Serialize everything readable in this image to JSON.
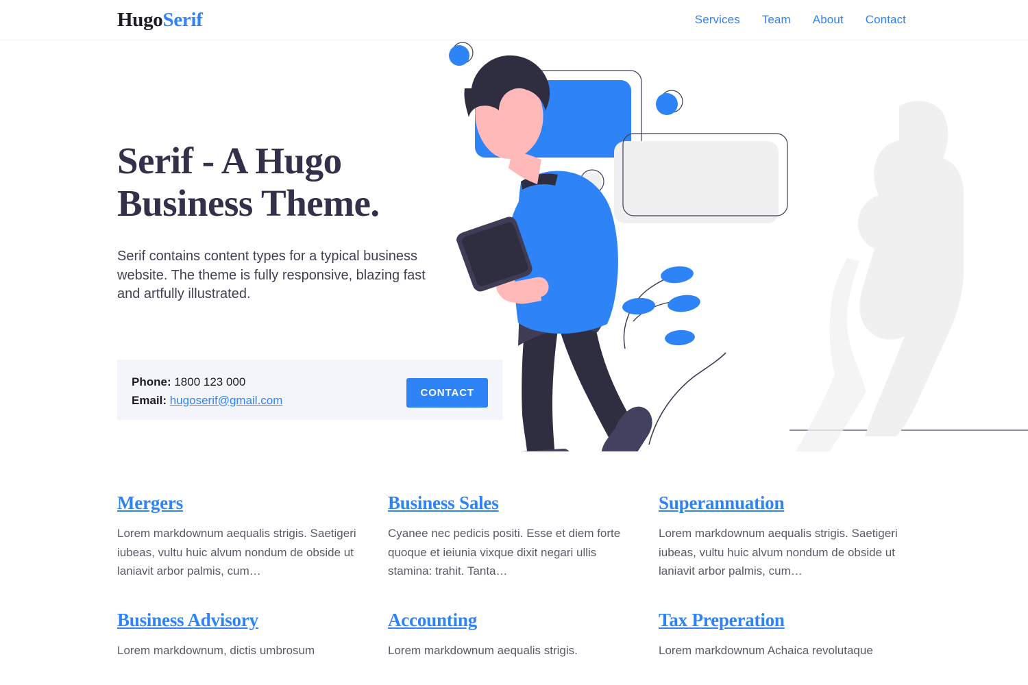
{
  "header": {
    "logo": {
      "primary": "Hugo",
      "accent": "Serif"
    },
    "nav": [
      {
        "label": "Services",
        "name": "nav-link-services"
      },
      {
        "label": "Team",
        "name": "nav-link-team"
      },
      {
        "label": "About",
        "name": "nav-link-about"
      },
      {
        "label": "Contact",
        "name": "nav-link-contact"
      }
    ]
  },
  "hero": {
    "title_line1": "Serif - A Hugo",
    "title_line2": "Business Theme.",
    "subtitle": "Serif contains content types for a typical business website. The theme is fully responsive, blazing fast and artfully illustrated.",
    "contact": {
      "phone_label": "Phone:",
      "phone_value": "1800 123 000",
      "email_label": "Email:",
      "email_value": "hugoserif@gmail.com",
      "button_label": "CONTACT"
    },
    "illustration": {
      "alt": "man-walking-with-tablet-illustration",
      "shapes": [
        "blue-rounded-rect",
        "outlined-rounded-rect",
        "gray-rounded-rect",
        "blue-circle-small",
        "blue-circle-medium",
        "outline-circle-gray"
      ]
    }
  },
  "services": [
    {
      "title": "Mergers",
      "text": "Lorem markdownum aequalis strigis. Saetigeri iubeas, vultu huic alvum nondum de obside ut laniavit arbor palmis, cum…"
    },
    {
      "title": "Business Sales",
      "text": "Cyanee nec pedicis positi. Esse et diem forte quoque et ieiunia vixque dixit negari ullis stamina: trahit. Tanta…"
    },
    {
      "title": "Superannuation",
      "text": "Lorem markdownum aequalis strigis. Saetigeri iubeas, vultu huic alvum nondum de obside ut laniavit arbor palmis, cum…"
    },
    {
      "title": "Business Advisory",
      "text": "Lorem markdownum, dictis umbrosum"
    },
    {
      "title": "Accounting",
      "text": "Lorem markdownum aequalis strigis."
    },
    {
      "title": "Tax Preperation",
      "text": "Lorem markdownum Achaica revolutaque"
    }
  ],
  "colors": {
    "accent_blue": "#2e83f7",
    "headline_navy": "#333049",
    "body_gray": "#5b5966",
    "panel_bg": "#f4f5fa",
    "shadow_gray": "#f0f0f0",
    "skin": "#ffb9b9",
    "hair_navy": "#2f2e41",
    "pants_navy": "#2f2e41",
    "shoe_slate": "#434160"
  }
}
